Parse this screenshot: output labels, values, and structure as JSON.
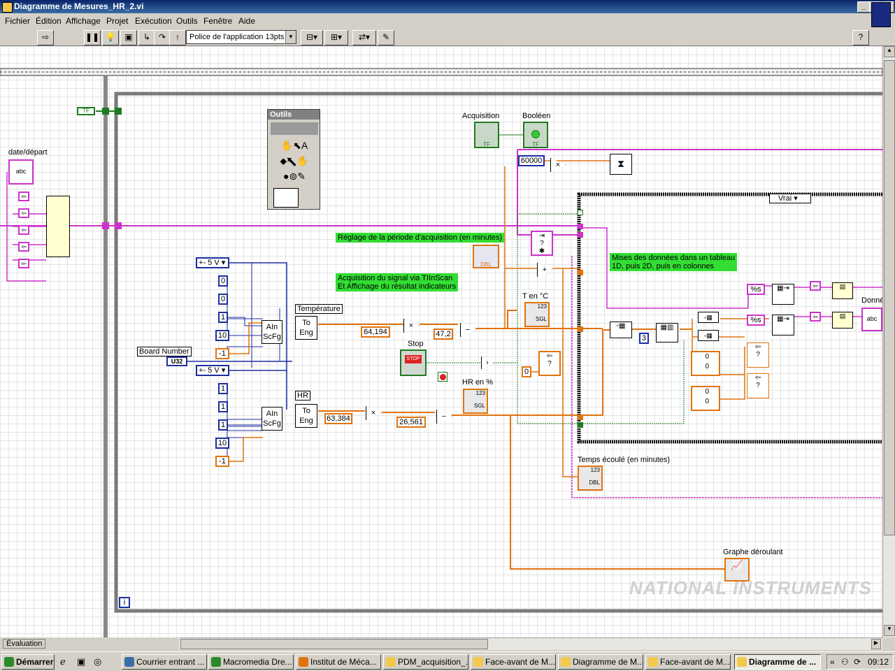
{
  "window": {
    "title": "Diagramme de Mesures_HR_2.vi"
  },
  "menu": [
    "Fichier",
    "Édition",
    "Affichage",
    "Projet",
    "Exécution",
    "Outils",
    "Fenêtre",
    "Aide"
  ],
  "toolbar": {
    "font": "Police de l'application 13pts"
  },
  "tools_palette": {
    "title": "Outils"
  },
  "diagram": {
    "labels": {
      "date_depart": "date/départ",
      "acquisition": "Acquisition",
      "booleen": "Booléen",
      "temperature": "Température",
      "hr": "HR",
      "board_number": "Board Number",
      "stop": "Stop",
      "t_en_c": "T en °C",
      "hr_en_pct": "HR en %",
      "temps_ecoule": "Temps écoulé (en minutes)",
      "graphe": "Graphe déroulant",
      "donnees": "Donné"
    },
    "comments": {
      "reglage": "Réglage de la période d'acquisition (en minutes)",
      "acq_signal": "Acquisition du signal via TIInScan\nEt Affichage du résultat indicateurs",
      "mises": "Mises des données dans un tableau\n1D, puis 2D, puis en colonnes"
    },
    "constants": {
      "range1": "+- 5 V",
      "range2": "+- 5 V",
      "c0a": "0",
      "c0b": "0",
      "c1a": "1",
      "c10a": "10",
      "cm1a": "-1",
      "c1b": "1",
      "c1c": "1",
      "c1d": "1",
      "c10b": "10",
      "cm1b": "-1",
      "k1": "64,194",
      "k2": "47,2",
      "k3": "63,384",
      "k4": "26,561",
      "k60000": "60000",
      "k0": "0",
      "k3b": "3",
      "u32": "U32",
      "case_sel": "Vrai",
      "pct_s1": "%s",
      "pct_s2": "%s",
      "arr0a": "0",
      "arr0b": "0",
      "arr0c": "0",
      "arr0d": "0",
      "iter": "i"
    },
    "nodes": {
      "ain1": "AIn\nScFg",
      "ain2": "AIn\nScFg",
      "toeng1": "To\nEng",
      "toeng2": "To\nEng",
      "tf": "TF",
      "dbl": "DBL",
      "sgl": "SGL",
      "num": "123",
      "abc": "abc",
      "stop_btn": "STOP"
    }
  },
  "status": {
    "mode": "Évaluation"
  },
  "watermark": "NATIONAL INSTRUMENTS",
  "taskbar": {
    "start": "Démarrer",
    "tasks": [
      "Courrier entrant ...",
      "Macromedia Dre...",
      "Institut de Méca...",
      "PDM_acquisition_...",
      "Face-avant de M...",
      "Diagramme de M...",
      "Face-avant de M...",
      "Diagramme de ..."
    ],
    "time": "09:12"
  },
  "colors": {
    "wire_orange": "#e0730f",
    "wire_blue": "#1c2fa0",
    "wire_pink": "#cc33cc",
    "wire_green": "#1f7a1f",
    "comment": "#33dd33"
  }
}
